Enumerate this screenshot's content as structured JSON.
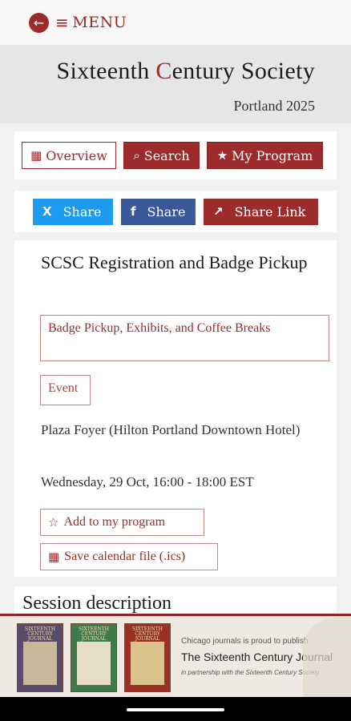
{
  "topbar": {
    "back_icon": "arrow-left-circle-icon",
    "menu_label": "MENU"
  },
  "header": {
    "title_pre": "Sixteenth ",
    "title_c": "C",
    "title_post": "entury Society",
    "subtitle": "Portland 2025"
  },
  "nav": {
    "overview": "Overview",
    "search": "Search",
    "my_program": "My Program"
  },
  "share": {
    "x": "Share",
    "facebook": "Share",
    "link": "Share Link"
  },
  "session": {
    "title": "SCSC Registration and Badge Pickup",
    "track": "Badge Pickup, Exhibits, and Coffee Breaks",
    "type": "Event",
    "location": "Plaza Foyer (Hilton Portland Downtown Hotel)",
    "datetime": "Wednesday, 29 Oct, 16:00 - 18:00 EST",
    "add_label": "Add to my program",
    "ics_label": "Save calendar file (.ics)"
  },
  "description": {
    "heading": "Session description"
  },
  "ad": {
    "line1": "Chicago journals is proud to publish",
    "line2": "The Sixteenth Century Journal",
    "line3": "in partnership with the Sixteenth Century Society",
    "cover_title_1": "SIXTEENTH CENTURY JOURNAL",
    "cover_title_2": "SIXTEENTH CENTURY JOURNAL",
    "cover_title_3": "SIXTEENTH CENTURY JOURNAL"
  },
  "colors": {
    "brand": "#9c2b2b",
    "x_blue": "#1d9bf0",
    "facebook_blue": "#3b5998"
  }
}
